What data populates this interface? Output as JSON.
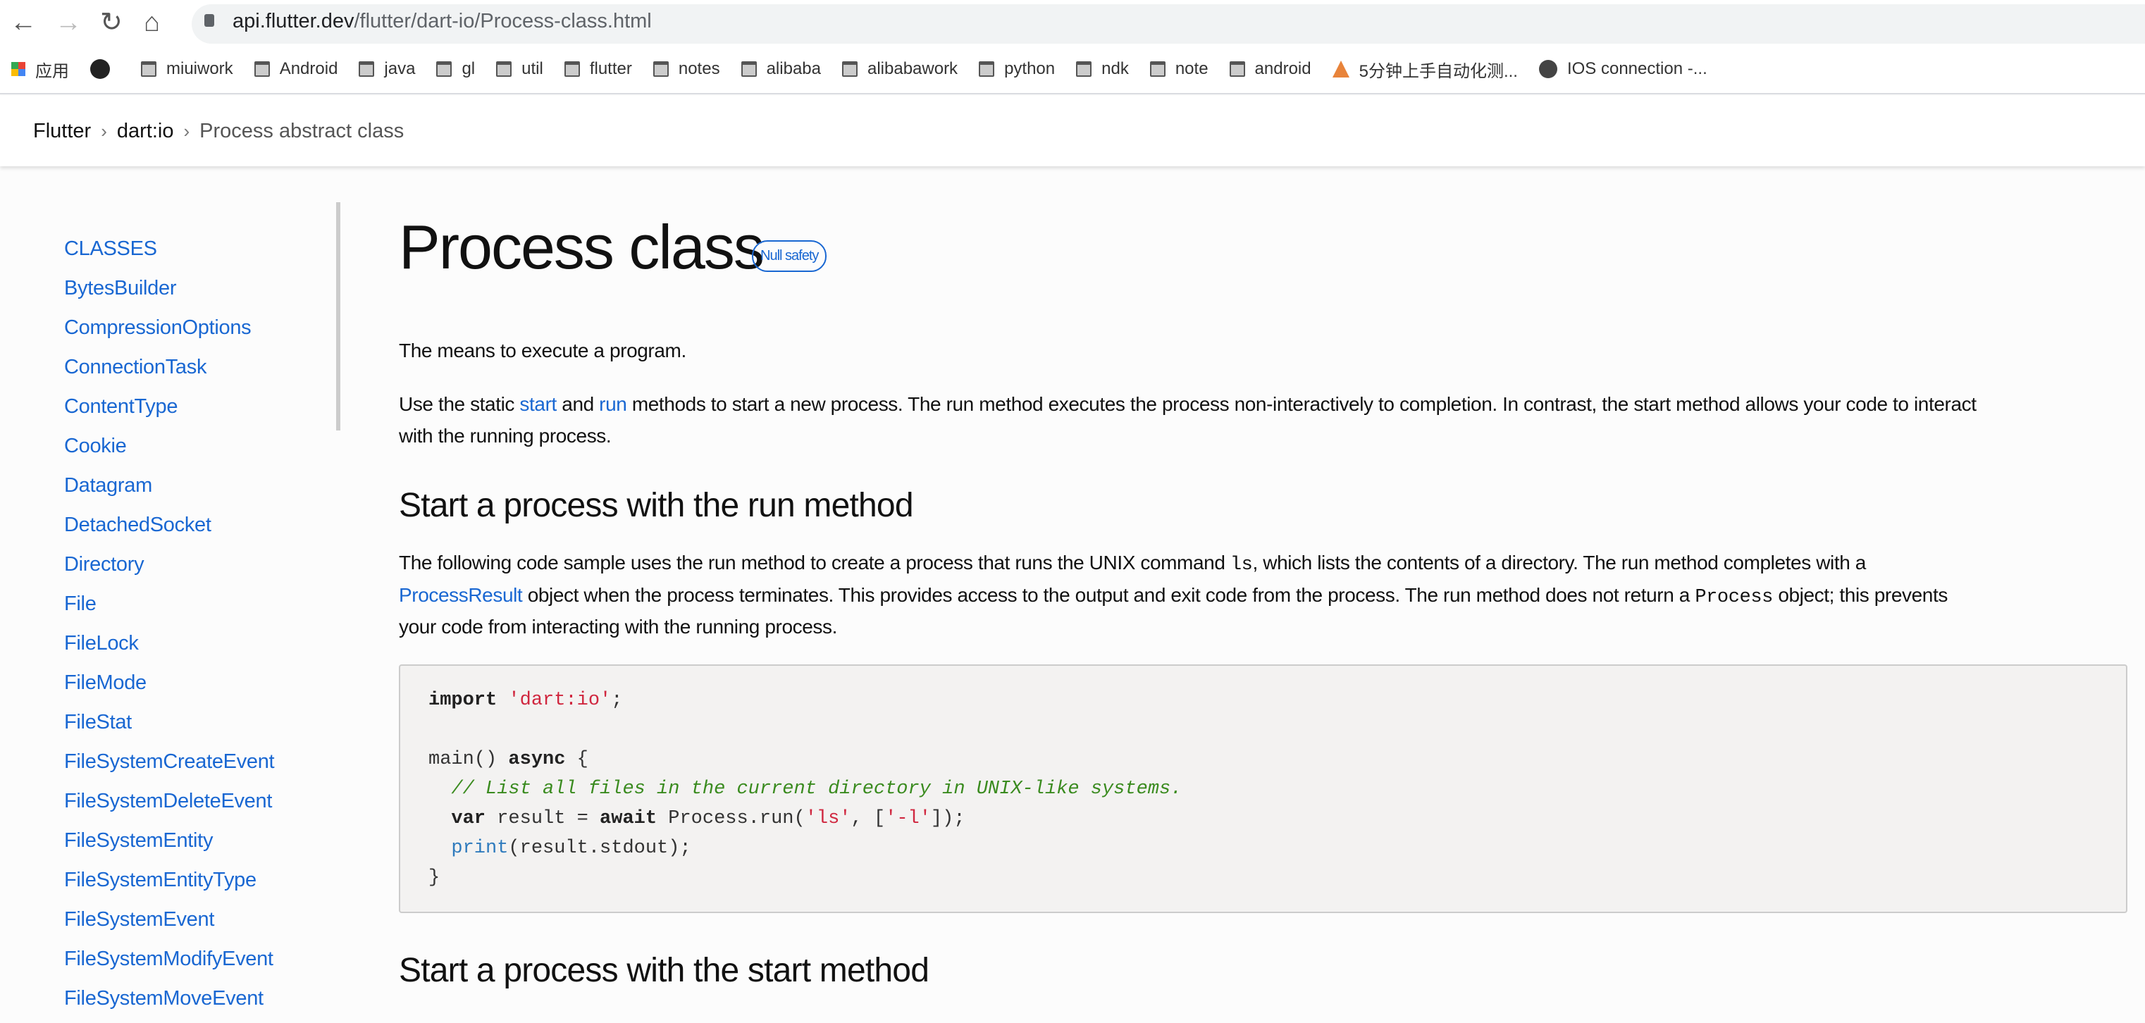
{
  "browser": {
    "url_host": "api.flutter.dev",
    "url_path": "/flutter/dart-io/Process-class.html",
    "bookmarks": [
      {
        "label": "应用",
        "icon": "apps-grid-icon"
      },
      {
        "label": "",
        "icon": "github-icon"
      },
      {
        "label": "miuiwork",
        "icon": "folder-icon"
      },
      {
        "label": "Android",
        "icon": "folder-icon"
      },
      {
        "label": "java",
        "icon": "folder-icon"
      },
      {
        "label": "gl",
        "icon": "folder-icon"
      },
      {
        "label": "util",
        "icon": "folder-icon"
      },
      {
        "label": "flutter",
        "icon": "folder-icon"
      },
      {
        "label": "notes",
        "icon": "folder-icon"
      },
      {
        "label": "alibaba",
        "icon": "folder-icon"
      },
      {
        "label": "alibabawork",
        "icon": "folder-icon"
      },
      {
        "label": "python",
        "icon": "folder-icon"
      },
      {
        "label": "ndk",
        "icon": "folder-icon"
      },
      {
        "label": "note",
        "icon": "folder-icon"
      },
      {
        "label": "android",
        "icon": "folder-icon"
      },
      {
        "label": "5分钟上手自动化测...",
        "icon": "triangle-logo-icon"
      },
      {
        "label": "IOS connection -...",
        "icon": "globe-icon"
      }
    ]
  },
  "breadcrumb": [
    "Flutter",
    "dart:io",
    "Process abstract class"
  ],
  "sidebar": {
    "heading": "CLASSES",
    "items": [
      "BytesBuilder",
      "CompressionOptions",
      "ConnectionTask",
      "ContentType",
      "Cookie",
      "Datagram",
      "DetachedSocket",
      "Directory",
      "File",
      "FileLock",
      "FileMode",
      "FileStat",
      "FileSystemCreateEvent",
      "FileSystemDeleteEvent",
      "FileSystemEntity",
      "FileSystemEntityType",
      "FileSystemEvent",
      "FileSystemModifyEvent",
      "FileSystemMoveEvent"
    ]
  },
  "main": {
    "title": "Process class",
    "badge": "Null safety",
    "intro": "The means to execute a program.",
    "p2": {
      "a": "Use the static ",
      "link1": "start",
      "b": " and ",
      "link2": "run",
      "c": " methods to start a new process. The run method executes the process non-interactively to completion. In contrast, the start method allows your code to interact",
      "line2": "with the running process."
    },
    "h2_run": "Start a process with the run method",
    "p3": {
      "a": "The following code sample uses the run method to create a process that runs the UNIX command ",
      "code1": "ls",
      "b": ", which lists the contents of a directory. The run method completes with a",
      "link": "ProcessResult",
      "c": " object when the process terminates. This provides access to the output and exit code from the process. The run method does not return a ",
      "code2": "Process",
      "d": " object; this prevents",
      "line3": "your code from interacting with the running process."
    },
    "code": {
      "l1_kw": "import",
      "l1_str": "'dart:io'",
      "l1_end": ";",
      "l3_a": "main() ",
      "l3_kw": "async",
      "l3_b": " {",
      "l4": "  // List all files in the current directory in UNIX-like systems.",
      "l5_kw1": "var",
      "l5_a": " result = ",
      "l5_kw2": "await",
      "l5_b": " Process.run(",
      "l5_s1": "'ls'",
      "l5_c": ", [",
      "l5_s2": "'-l'",
      "l5_d": "]);",
      "l6_fn": "print",
      "l6_a": "(result.stdout);",
      "l7": "}"
    },
    "h2_start": "Start a process with the start method"
  }
}
